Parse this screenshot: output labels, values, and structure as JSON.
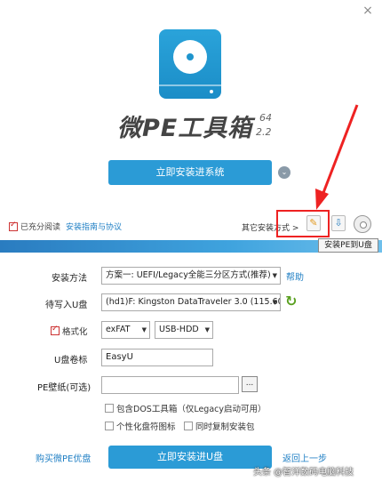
{
  "window": {
    "close_glyph": "×"
  },
  "brand": {
    "title": "微PE工具箱",
    "version_major": "64",
    "version_minor": "2.2"
  },
  "top": {
    "install_label": "立即安装进系统",
    "chevron_glyph": "⌄",
    "agree_text": "已充分阅读",
    "agree_link": "安装指南与协议",
    "other_methods": "其它安装方式 >",
    "tooltip": "安装PE到U盘"
  },
  "form": {
    "method_label": "安装方法",
    "method_value": "方案一: UEFI/Legacy全能三分区方式(推荐)",
    "help_label": "帮助",
    "disk_label": "待写入U盘",
    "disk_value": "(hd1)F: Kingston DataTraveler 3.0 (115.60",
    "format_label": "格式化",
    "fs_value": "exFAT",
    "mode_value": "USB-HDD",
    "volume_label": "U盘卷标",
    "volume_value": "EasyU",
    "wallpaper_label": "PE壁纸(可选)",
    "wallpaper_value": "",
    "browse_label": "...",
    "opt_dos": "包含DOS工具箱（仅Legacy启动可用）",
    "opt_icon": "个性化盘符图标",
    "opt_copy": "同时复制安装包"
  },
  "footer": {
    "buy_label": "购买微PE优盘",
    "install_label": "立即安装进U盘",
    "back_label": "返回上一步",
    "watermark": "头条 @智洋数码电脑科技"
  },
  "colors": {
    "accent": "#2b9bd6",
    "link": "#1f7fc4",
    "highlight": "#e22222"
  }
}
